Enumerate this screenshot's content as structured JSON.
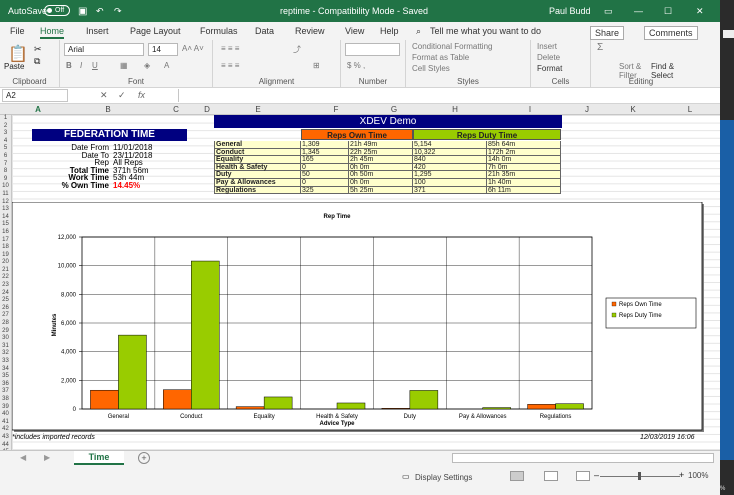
{
  "titlebar": {
    "autosave": "AutoSave",
    "toggle": "Off",
    "title": "reptime - Compatibility Mode - Saved",
    "user": "Paul Budd"
  },
  "menu": {
    "items": [
      "File",
      "Home",
      "Insert",
      "Page Layout",
      "Formulas",
      "Data",
      "Review",
      "View",
      "Help"
    ],
    "tell": "Tell me what you want to do",
    "share": "Share",
    "comments": "Comments"
  },
  "ribbon": {
    "paste": "Paste",
    "font": "Arial",
    "size": "14",
    "clipboard": "Clipboard",
    "font_group": "Font",
    "alignment": "Alignment",
    "number": "Number",
    "styles": "Styles",
    "cells": "Cells",
    "editing": "Editing",
    "cond_format": "Conditional Formatting",
    "format_table": "Format as Table",
    "cell_styles": "Cell Styles",
    "insert": "Insert",
    "delete": "Delete",
    "format": "Format",
    "sort": "Sort & Filter",
    "find": "Find & Select"
  },
  "formula": {
    "namebox": "A2",
    "fx": "fx"
  },
  "columns": [
    "A",
    "B",
    "C",
    "D",
    "E",
    "F",
    "G",
    "H",
    "I",
    "J",
    "K",
    "L"
  ],
  "rows": [
    "1",
    "2",
    "3",
    "4",
    "5",
    "6",
    "7",
    "8",
    "9",
    "10",
    "11",
    "12",
    "13",
    "14",
    "15",
    "16",
    "17",
    "18",
    "19",
    "20",
    "21",
    "22",
    "23",
    "24",
    "25",
    "26",
    "27",
    "28",
    "29",
    "30",
    "31",
    "32",
    "33",
    "34",
    "35",
    "36",
    "37",
    "38",
    "39",
    "40",
    "41",
    "42",
    "43",
    "44",
    "45"
  ],
  "sheet": {
    "banner": "XDEV Demo",
    "fed_title": "FEDERATION TIME",
    "fed_rows": [
      {
        "label": "Date From",
        "value": "11/01/2018"
      },
      {
        "label": "Date To",
        "value": "23/11/2018"
      },
      {
        "label": "Rep",
        "value": "All Reps"
      },
      {
        "label": "Total Time",
        "value": "371h 56m"
      },
      {
        "label": "Work Time",
        "value": "53h 44m"
      },
      {
        "label": "% Own Time",
        "value": "14.45%"
      }
    ],
    "own_header": "Reps Own Time",
    "duty_header": "Reps Duty Time",
    "table": [
      {
        "cat": "General",
        "own_n": "1,309",
        "own_t": "21h 49m",
        "duty_n": "5,154",
        "duty_t": "85h 64m"
      },
      {
        "cat": "Conduct",
        "own_n": "1,345",
        "own_t": "22h 25m",
        "duty_n": "10,322",
        "duty_t": "172h 2m"
      },
      {
        "cat": "Equality",
        "own_n": "165",
        "own_t": "2h 45m",
        "duty_n": "840",
        "duty_t": "14h 0m"
      },
      {
        "cat": "Health & Safety",
        "own_n": "0",
        "own_t": "0h 0m",
        "duty_n": "420",
        "duty_t": "7h 0m"
      },
      {
        "cat": "Duty",
        "own_n": "50",
        "own_t": "0h 50m",
        "duty_n": "1,295",
        "duty_t": "21h 35m"
      },
      {
        "cat": "Pay & Allowances",
        "own_n": "0",
        "own_t": "0h 0m",
        "duty_n": "100",
        "duty_t": "1h 40m"
      },
      {
        "cat": "Regulations",
        "own_n": "325",
        "own_t": "5h 25m",
        "duty_n": "371",
        "duty_t": "6h 11m"
      }
    ],
    "footnote": "*includes imported records",
    "timestamp": "12/03/2019 16:06"
  },
  "colors": {
    "own": "#ff6600",
    "duty": "#99cc00",
    "navy": "#000080",
    "excel_green": "#217346"
  },
  "chart_data": {
    "type": "bar",
    "title": "Rep Time",
    "xlabel": "Advice Type",
    "ylabel": "Minutes",
    "categories": [
      "General",
      "Conduct",
      "Equality",
      "Health & Safety",
      "Duty",
      "Pay & Allowances",
      "Regulations"
    ],
    "series": [
      {
        "name": "Reps Own Time",
        "values": [
          1309,
          1345,
          165,
          0,
          50,
          0,
          325
        ]
      },
      {
        "name": "Reps Duty Time",
        "values": [
          5154,
          10322,
          840,
          420,
          1295,
          100,
          371
        ]
      }
    ],
    "yticks": [
      "0",
      "2,000",
      "4,000",
      "6,000",
      "8,000",
      "10,000",
      "12,000"
    ],
    "ylim": [
      0,
      12000
    ],
    "legend": "right",
    "grid": true
  },
  "tabs": {
    "active": "Time",
    "add": "+"
  },
  "status": {
    "display": "Display Settings",
    "zoom": "100%"
  }
}
